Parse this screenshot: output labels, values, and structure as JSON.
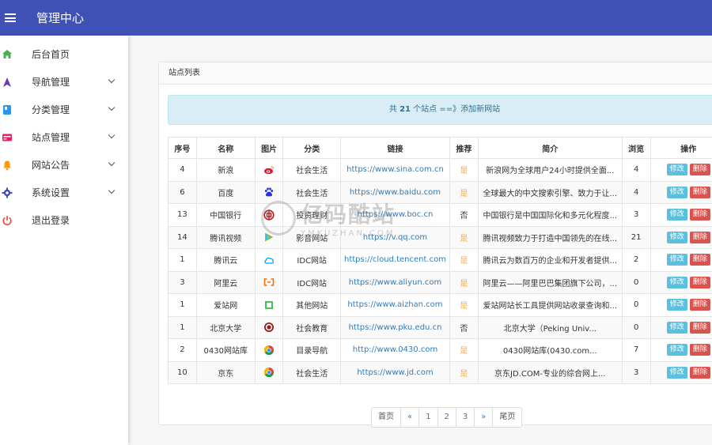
{
  "header": {
    "title": "管理中心"
  },
  "sidebar": {
    "items": [
      {
        "label": "后台首页",
        "icon": "home-icon",
        "color": "#4caf50",
        "chevron": false
      },
      {
        "label": "导航管理",
        "icon": "navigation-icon",
        "color": "#673ab7",
        "chevron": true
      },
      {
        "label": "分类管理",
        "icon": "category-icon",
        "color": "#2196f3",
        "chevron": true
      },
      {
        "label": "站点管理",
        "icon": "site-icon",
        "color": "#e91e63",
        "chevron": true
      },
      {
        "label": "网站公告",
        "icon": "bell-icon",
        "color": "#ff9800",
        "chevron": true
      },
      {
        "label": "系统设置",
        "icon": "gear-icon",
        "color": "#3f51b5",
        "chevron": true
      },
      {
        "label": "退出登录",
        "icon": "power-icon",
        "color": "#f44336",
        "chevron": false
      }
    ]
  },
  "panel": {
    "title": "站点列表",
    "alert": {
      "prefix": "共",
      "count": "21",
      "suffix": "个站点 ==》",
      "link": "添加新网站"
    }
  },
  "table": {
    "headers": [
      "序号",
      "名称",
      "图片",
      "分类",
      "链接",
      "推荐",
      "简介",
      "浏览",
      "操作"
    ],
    "edit_label": "修改",
    "delete_label": "删除",
    "rows": [
      {
        "id": "4",
        "name": "新浪",
        "icon": "sina-icon",
        "category": "社会生活",
        "url": "https://www.sina.com.cn",
        "recommended": "是",
        "desc": "新浪网为全球用户24小时提供全面...",
        "views": "4"
      },
      {
        "id": "6",
        "name": "百度",
        "icon": "baidu-icon",
        "category": "社会生活",
        "url": "https://www.baidu.com",
        "recommended": "是",
        "desc": "全球最大的中文搜索引擎、致力于让...",
        "views": "4"
      },
      {
        "id": "13",
        "name": "中国银行",
        "icon": "boc-icon",
        "category": "投资理财",
        "url": "https://www.boc.cn",
        "recommended": "否",
        "desc": "中国银行是中国国际化和多元化程度...",
        "views": "3"
      },
      {
        "id": "14",
        "name": "腾讯视频",
        "icon": "tencent-video-icon",
        "category": "影音网站",
        "url": "https://v.qq.com",
        "recommended": "是",
        "desc": "腾讯视频致力于打造中国领先的在线...",
        "views": "21"
      },
      {
        "id": "1",
        "name": "腾讯云",
        "icon": "tencent-cloud-icon",
        "category": "IDC网站",
        "url": "https://cloud.tencent.com",
        "recommended": "是",
        "desc": "腾讯云为数百万的企业和开发者提供...",
        "views": "2"
      },
      {
        "id": "3",
        "name": "阿里云",
        "icon": "aliyun-icon",
        "category": "IDC网站",
        "url": "https://www.aliyun.com",
        "recommended": "是",
        "desc": "阿里云——阿里巴巴集团旗下公司，...",
        "views": "0"
      },
      {
        "id": "1",
        "name": "爱站网",
        "icon": "aizhan-icon",
        "category": "其他网站",
        "url": "https://www.aizhan.com",
        "recommended": "是",
        "desc": "爱站网站长工具提供网站收录查询和...",
        "views": "0"
      },
      {
        "id": "1",
        "name": "北京大学",
        "icon": "pku-icon",
        "category": "社会教育",
        "url": "https://www.pku.edu.cn",
        "recommended": "否",
        "desc": "北京大学（Peking Univ...",
        "views": "0"
      },
      {
        "id": "2",
        "name": "0430网站库",
        "icon": "chrome-icon",
        "category": "目录导航",
        "url": "http://www.0430.com",
        "recommended": "是",
        "desc": "0430网站库(0430.com...",
        "views": "7"
      },
      {
        "id": "10",
        "name": "京东",
        "icon": "chrome-icon",
        "category": "社会生活",
        "url": "https://www.jd.com",
        "recommended": "是",
        "desc": "京东JD.COM-专业的综合网上...",
        "views": "3"
      }
    ]
  },
  "pager": {
    "items": [
      "首页",
      "«",
      "1",
      "2",
      "3",
      "»",
      "尾页"
    ]
  },
  "watermark": {
    "big": "亿码酷站",
    "small": "YMKUZHAN.COM"
  }
}
